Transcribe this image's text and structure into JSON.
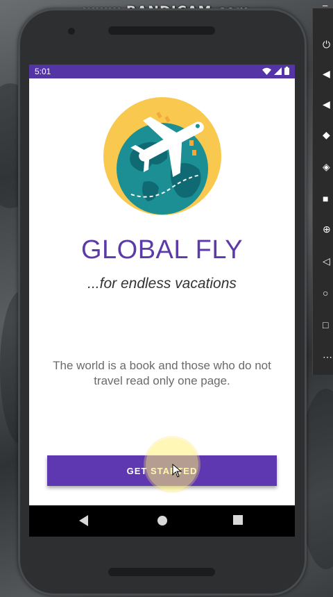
{
  "watermark": "www.BANDICAM.com",
  "status_bar": {
    "time": "5:01",
    "icons": [
      "wifi-icon",
      "signal-icon",
      "battery-icon"
    ]
  },
  "app": {
    "title": "GLOBAL FLY",
    "tagline": "...for endless vacations",
    "quote": "The world is a book and those who do not travel read only one page.",
    "cta_label": "GET STARTED"
  },
  "colors": {
    "primary": "#5d38b0",
    "status_bar": "#5534a6",
    "title": "#5c3aa8",
    "globe_ocean": "#1b8f93",
    "globe_land": "#0f6a73",
    "sun": "#f9c84f"
  },
  "nav_bar": {
    "buttons": [
      "back-icon",
      "home-icon",
      "recents-icon"
    ]
  },
  "emulator_toolbar": {
    "buttons": [
      "power-icon",
      "volume-up-icon",
      "volume-down-icon",
      "rotate-left-icon",
      "rotate-right-icon",
      "camera-icon",
      "zoom-icon",
      "back-icon",
      "home-icon",
      "overview-icon",
      "more-icon"
    ]
  }
}
